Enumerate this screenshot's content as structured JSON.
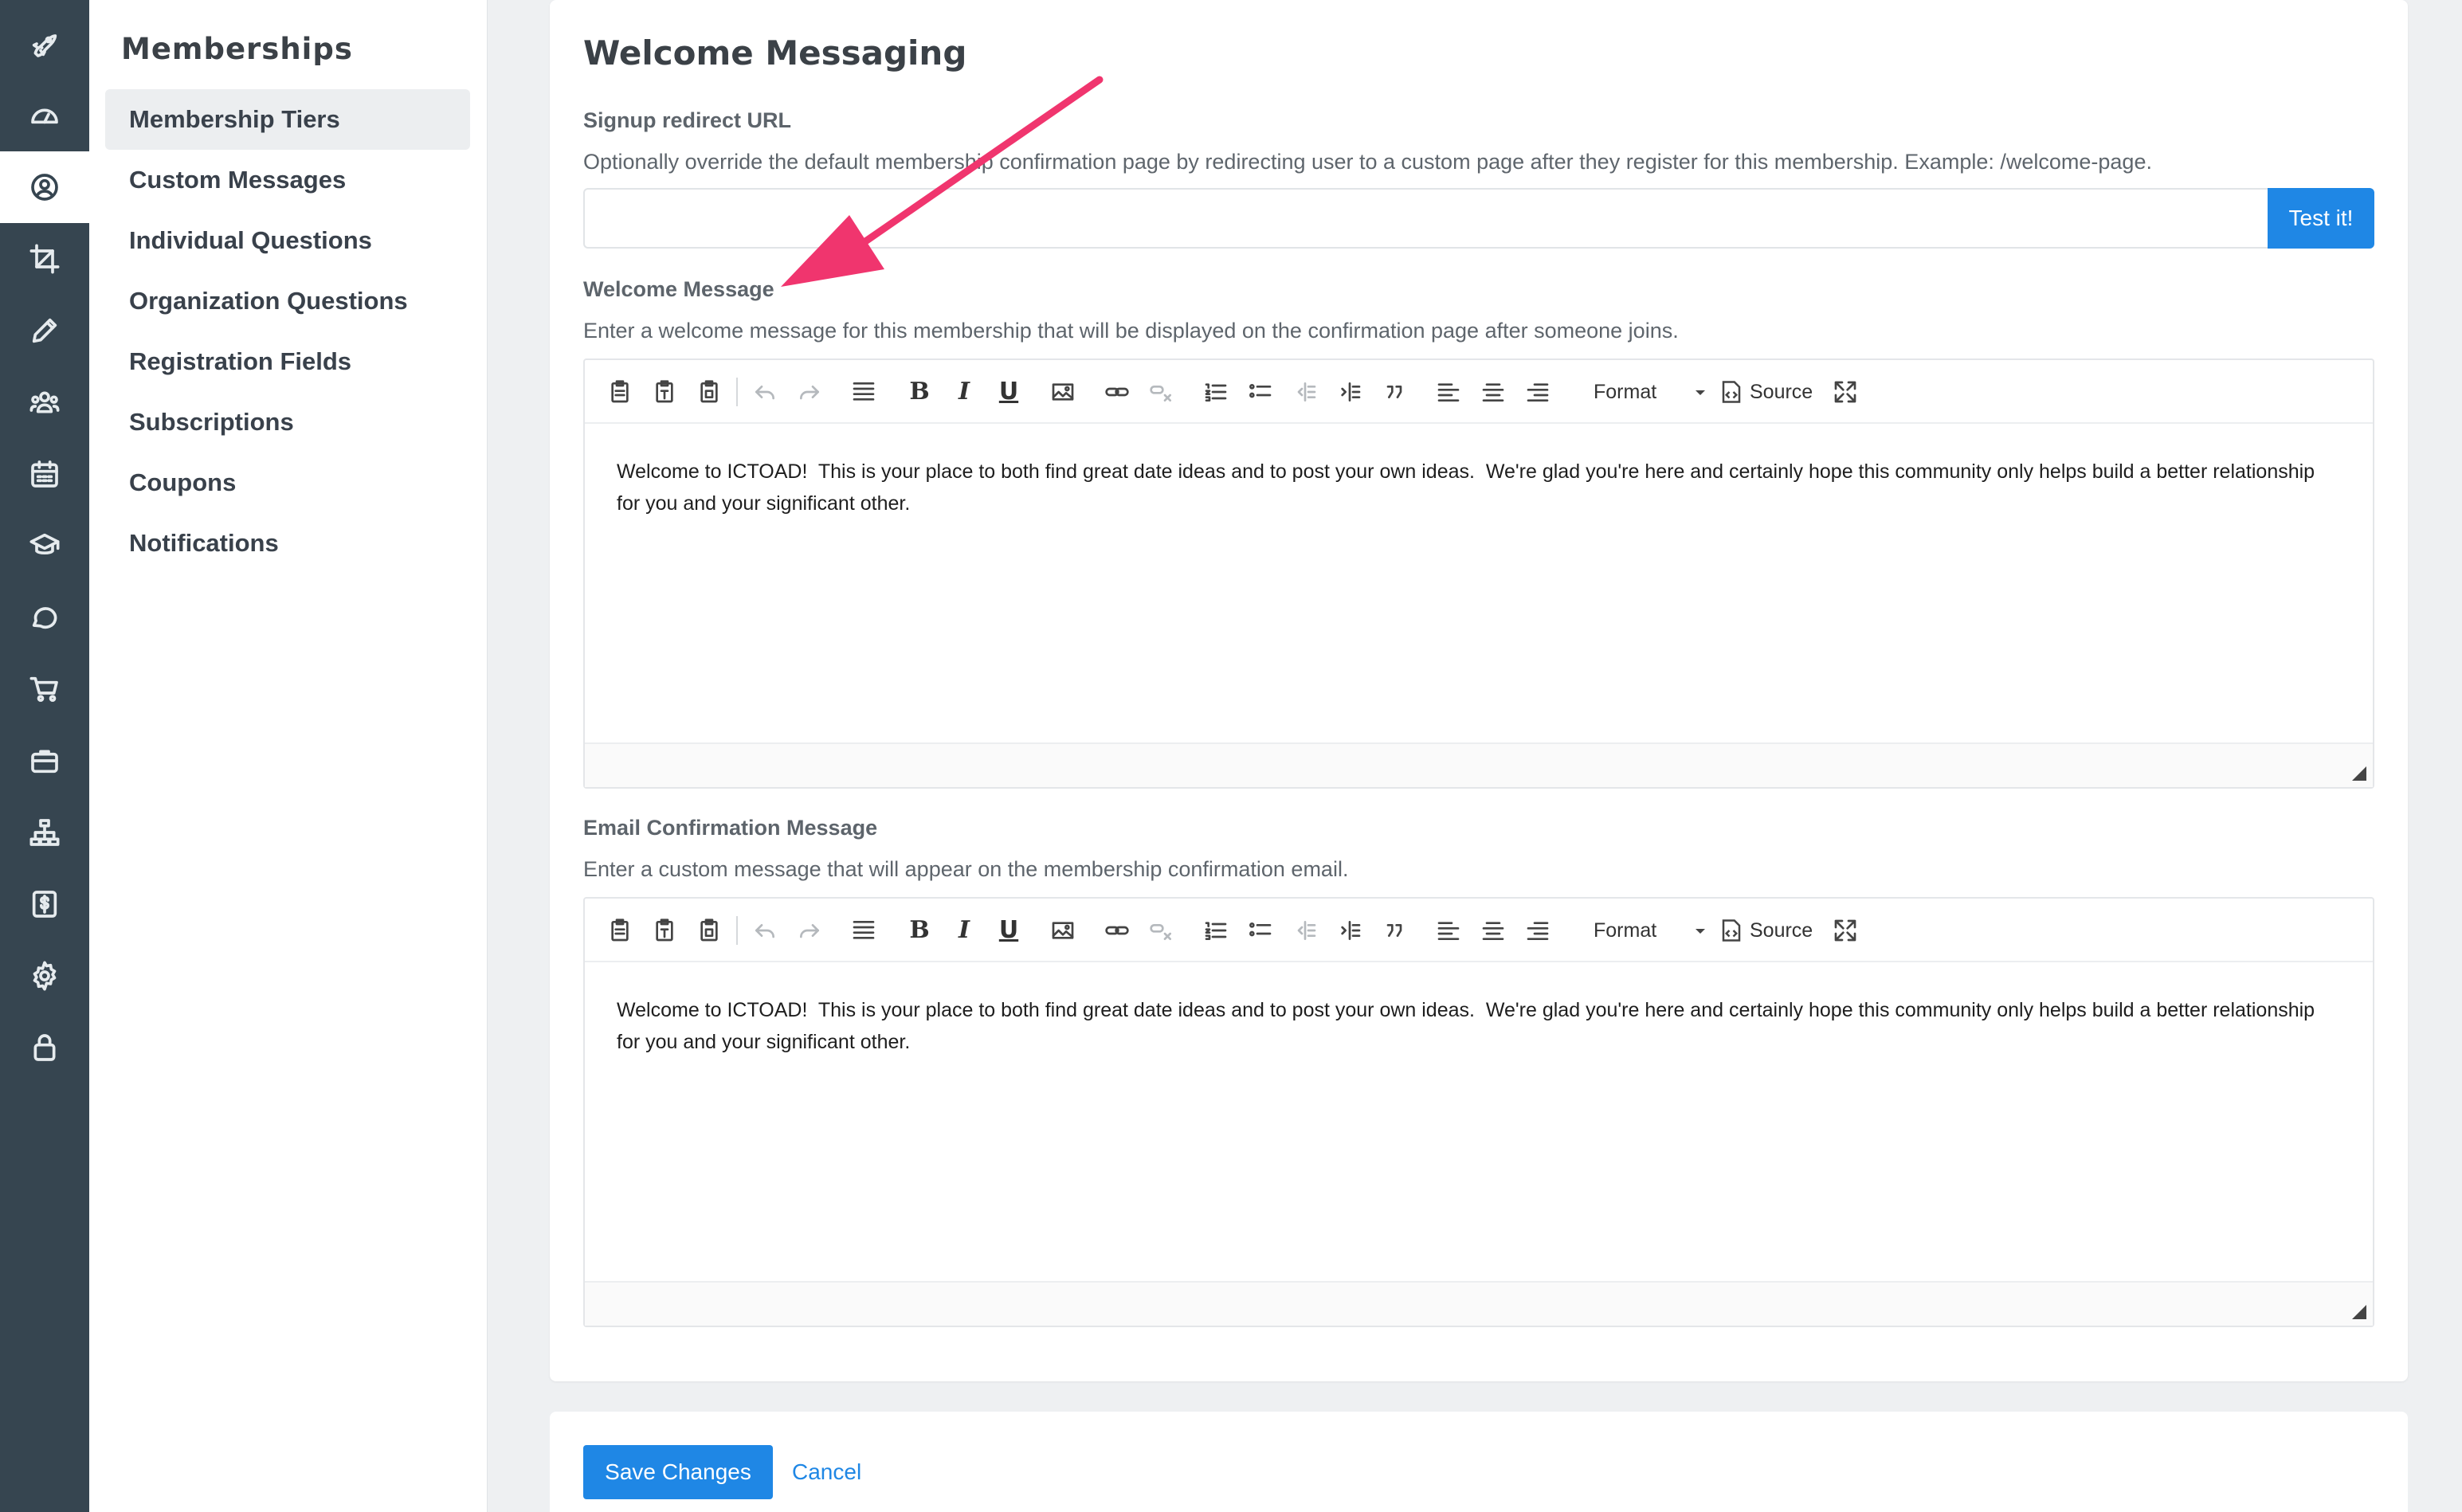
{
  "rail": {
    "items": [
      {
        "icon": "rocket-icon",
        "active": false
      },
      {
        "icon": "dashboard-icon",
        "active": false
      },
      {
        "icon": "user-circle-icon",
        "active": true
      },
      {
        "icon": "crop-icon",
        "active": false
      },
      {
        "icon": "pencil-icon",
        "active": false
      },
      {
        "icon": "users-icon",
        "active": false
      },
      {
        "icon": "calendar-icon",
        "active": false
      },
      {
        "icon": "graduation-cap-icon",
        "active": false
      },
      {
        "icon": "chat-bubble-icon",
        "active": false
      },
      {
        "icon": "cart-icon",
        "active": false
      },
      {
        "icon": "briefcase-icon",
        "active": false
      },
      {
        "icon": "sitemap-icon",
        "active": false
      },
      {
        "icon": "dollar-icon",
        "active": false
      },
      {
        "icon": "gear-icon",
        "active": false
      },
      {
        "icon": "lock-icon",
        "active": false
      }
    ]
  },
  "subnav": {
    "title": "Memberships",
    "items": [
      {
        "label": "Membership Tiers",
        "active": true
      },
      {
        "label": "Custom Messages",
        "active": false
      },
      {
        "label": "Individual Questions",
        "active": false
      },
      {
        "label": "Organization Questions",
        "active": false
      },
      {
        "label": "Registration Fields",
        "active": false
      },
      {
        "label": "Subscriptions",
        "active": false
      },
      {
        "label": "Coupons",
        "active": false
      },
      {
        "label": "Notifications",
        "active": false
      }
    ]
  },
  "main": {
    "title": "Welcome Messaging",
    "signup": {
      "label": "Signup redirect URL",
      "help": "Optionally override the default membership confirmation page by redirecting user to a custom page after they register for this membership. Example: /welcome-page.",
      "value": "",
      "test_label": "Test it!"
    },
    "welcome": {
      "label": "Welcome Message",
      "help": "Enter a welcome message for this membership that will be displayed on the confirmation page after someone joins.",
      "content": "Welcome to ICTOAD!  This is your place to both find great date ideas and to post your own ideas.  We're glad you're here and certainly hope this community only helps build a better relationship for you and your significant other."
    },
    "email": {
      "label": "Email Confirmation Message",
      "help": "Enter a custom message that will appear on the membership confirmation email.",
      "content": "Welcome to ICTOAD!  This is your place to both find great date ideas and to post your own ideas.  We're glad you're here and certainly hope this community only helps build a better relationship for you and your significant other."
    },
    "toolbar": {
      "bold": "B",
      "italic": "I",
      "underline": "U",
      "format": "Format",
      "source": "Source"
    }
  },
  "footer": {
    "save_label": "Save Changes",
    "cancel_label": "Cancel"
  },
  "colors": {
    "rail": "#364550",
    "primary": "#1f87e5",
    "annotation_arrow": "#f0356e"
  }
}
